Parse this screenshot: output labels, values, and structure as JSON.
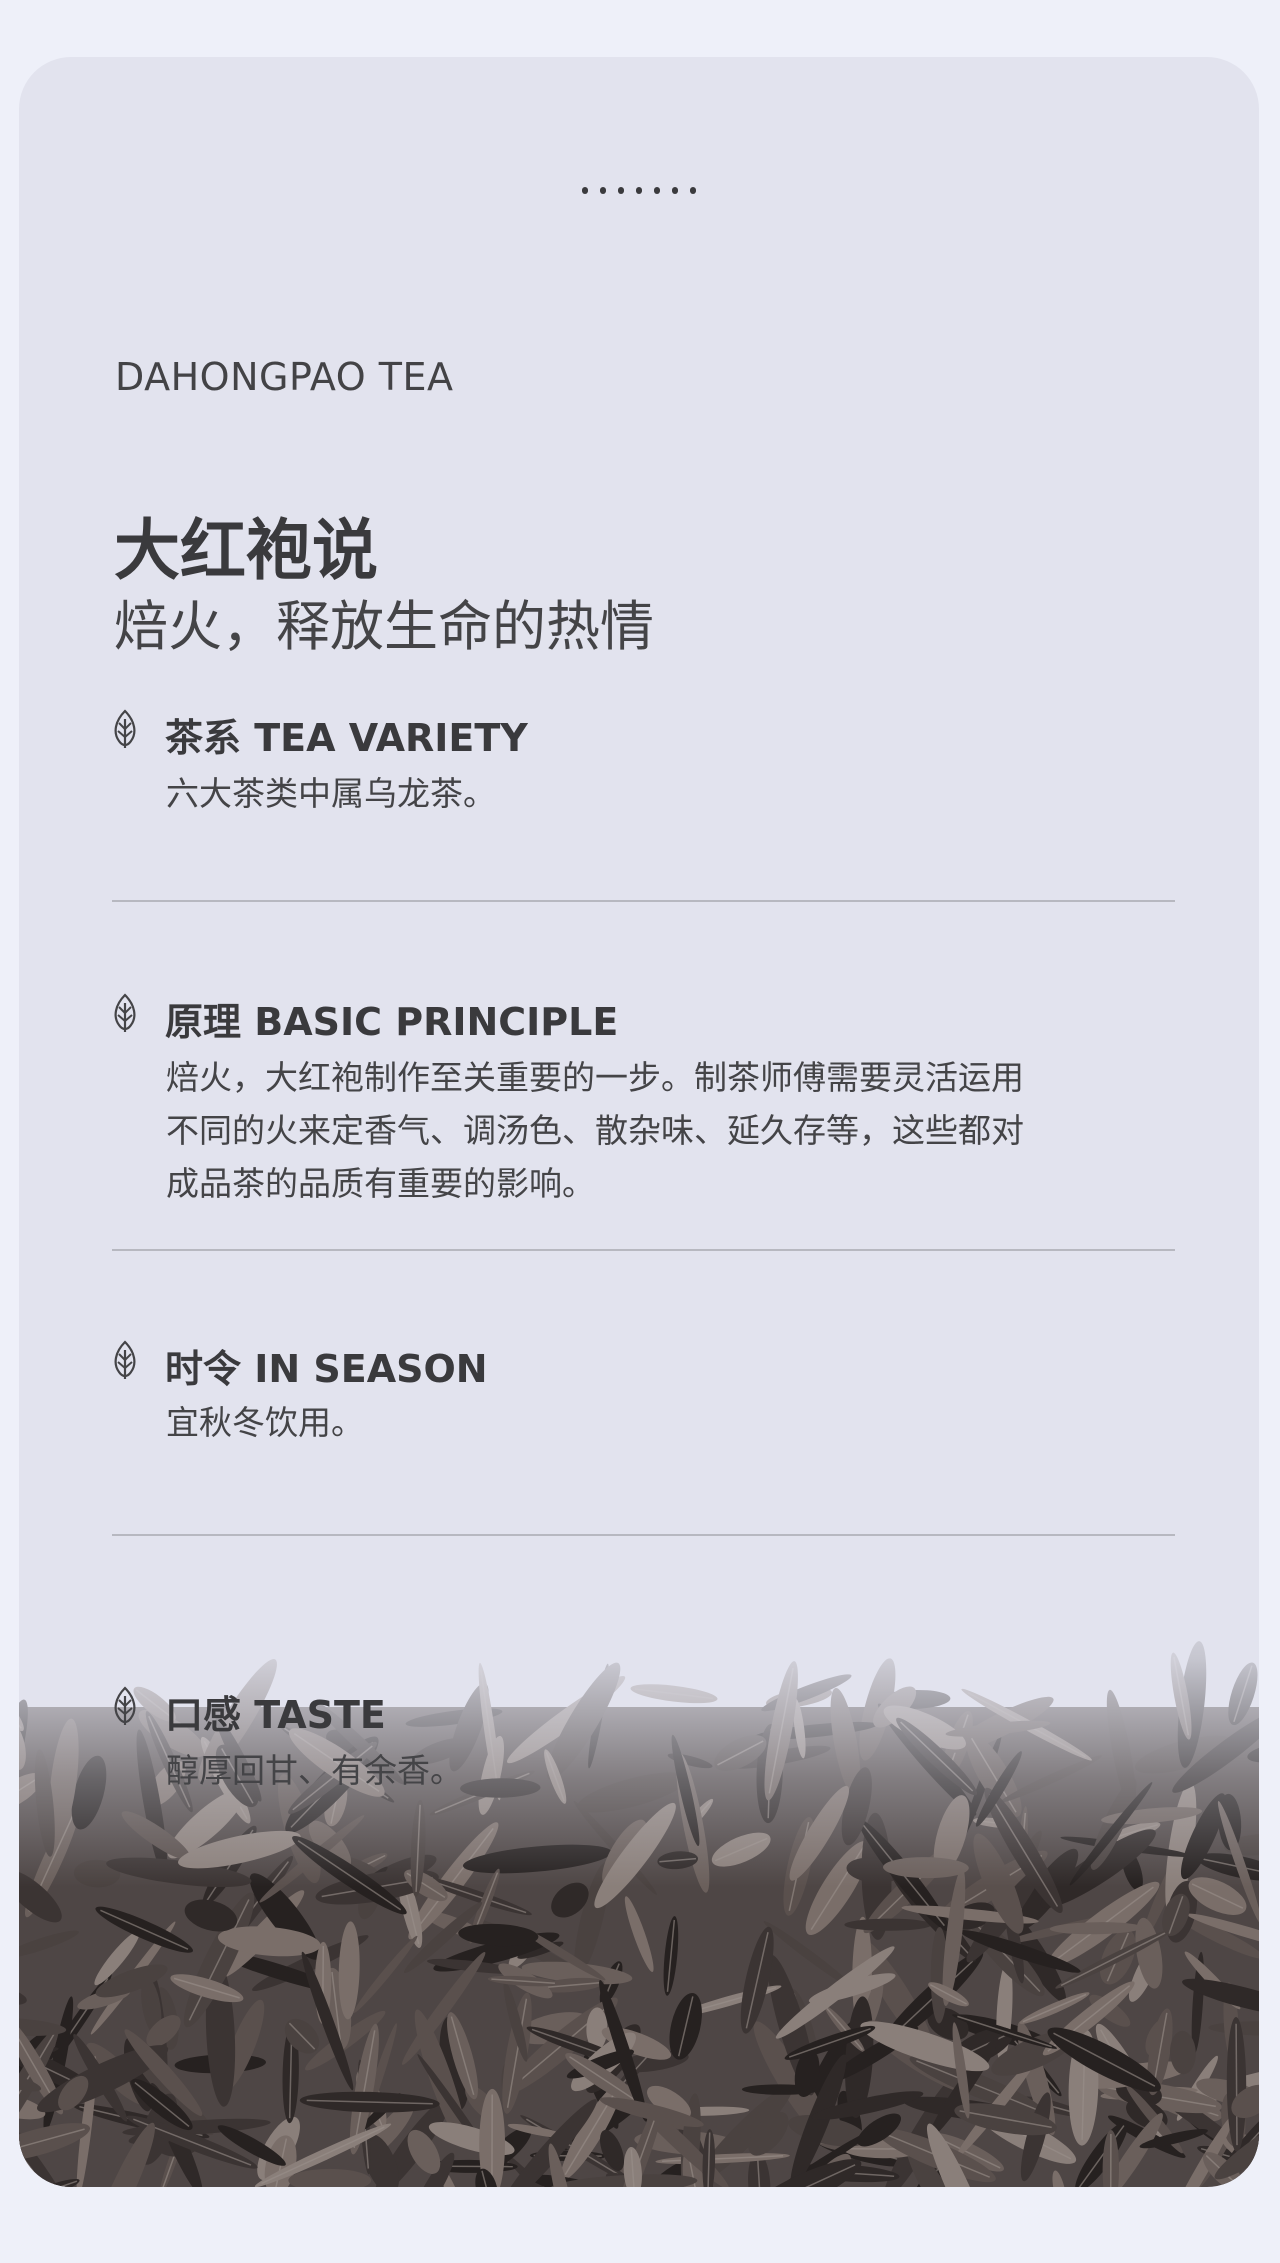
{
  "header": {
    "dots": 7,
    "subtitle_en": "DAHONGPAO TEA",
    "title": "大红袍说",
    "tagline": "焙火，释放生命的热情"
  },
  "sections": [
    {
      "title": "茶系 TEA VARIETY",
      "body": "六大茶类中属乌龙茶。",
      "icon": "leaf-icon"
    },
    {
      "title": "原理 BASIC PRINCIPLE",
      "body_lines": [
        "焙火，大红袍制作至关重要的一步。制茶师傅需要灵活运用",
        "不同的火来定香气、调汤色、散杂味、延久存等，这些都对",
        "成品茶的品质有重要的影响。"
      ],
      "icon": "leaf-icon"
    },
    {
      "title": "时令 IN SEASON",
      "body": "宜秋冬饮用。",
      "icon": "leaf-icon"
    },
    {
      "title": "口感 TASTE",
      "body": "醇厚回甘、有余香。",
      "icon": "leaf-icon"
    }
  ],
  "colors": {
    "page_bg": "#eef0f9",
    "card_bg": "#e2e3ee",
    "text_dark": "#3a3a3d",
    "rule": "#b7b8c0",
    "leaf_dark": "#3b3433"
  }
}
